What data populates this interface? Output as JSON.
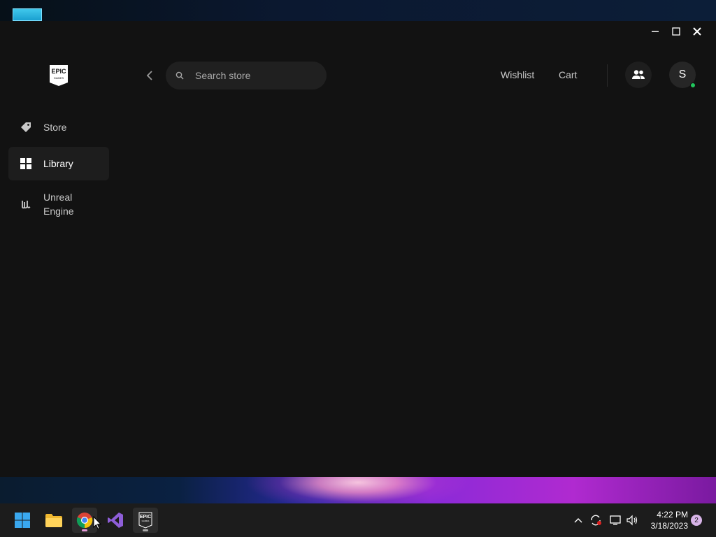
{
  "app": {
    "logo_text_top": "EPIC",
    "logo_text_bottom": "GAMES"
  },
  "sidebar": {
    "items": [
      {
        "label": "Store",
        "icon": "tag-icon"
      },
      {
        "label": "Library",
        "icon": "grid-icon",
        "active": true
      },
      {
        "label_line1": "Unreal",
        "label_line2": "Engine",
        "icon": "unreal-icon"
      }
    ]
  },
  "header": {
    "search_placeholder": "Search store",
    "wishlist": "Wishlist",
    "cart": "Cart",
    "avatar_initial": "S"
  },
  "taskbar": {
    "time": "4:22 PM",
    "date": "3/18/2023",
    "notifications": "2",
    "epic_label_top": "EPIC",
    "epic_label_bottom": "GAMES"
  },
  "colors": {
    "app_bg": "#121212",
    "active_nav": "#1d1d1d",
    "status_online": "#21c55d"
  }
}
